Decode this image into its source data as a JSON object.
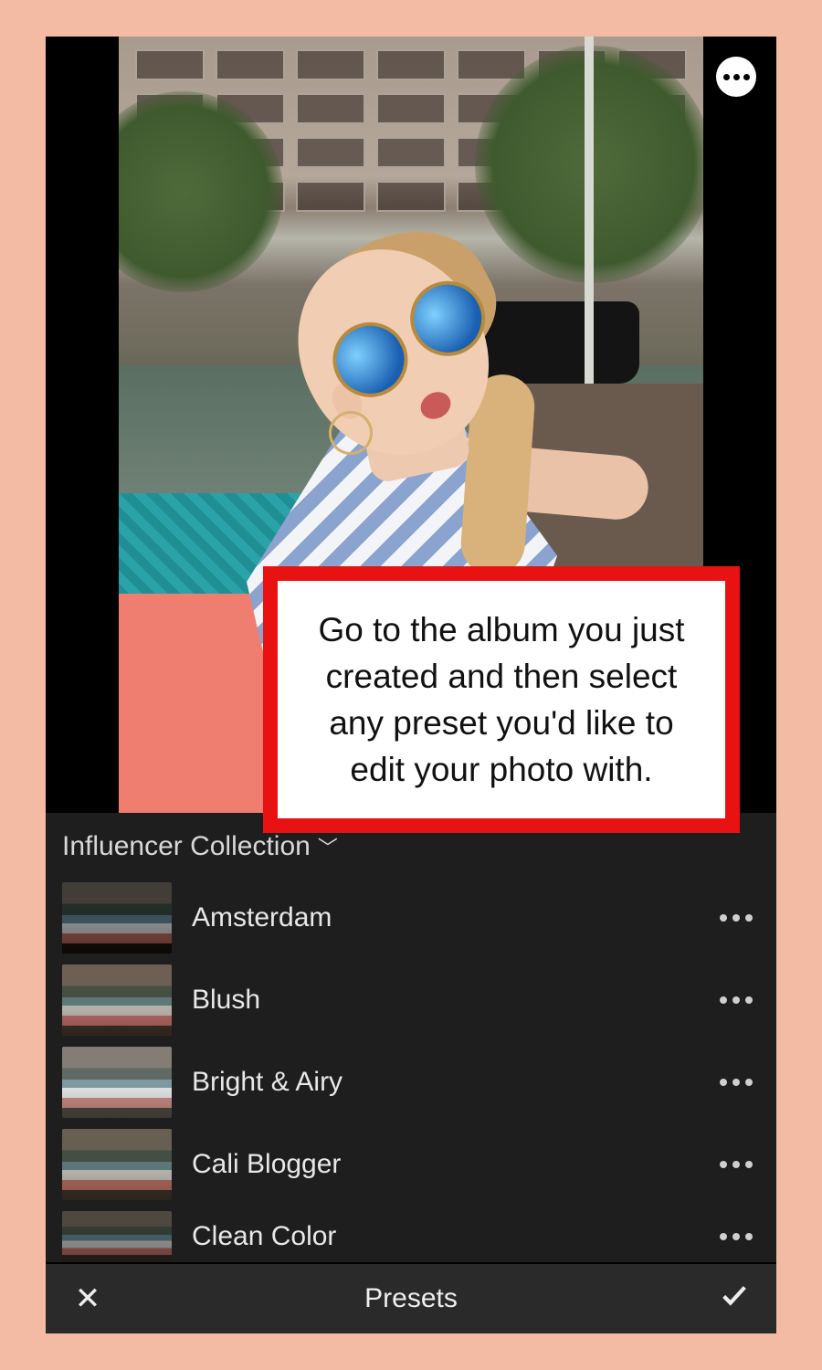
{
  "more_icon_name": "more-options",
  "presets_panel": {
    "header_label": "Influencer Collection",
    "items": [
      {
        "label": "Amsterdam"
      },
      {
        "label": "Blush"
      },
      {
        "label": "Bright & Airy"
      },
      {
        "label": "Cali Blogger"
      },
      {
        "label": "Clean Color"
      }
    ]
  },
  "bottom_bar": {
    "label": "Presets"
  },
  "callout_text": "Go to the album you just created and then select any preset you'd like to edit your photo with."
}
